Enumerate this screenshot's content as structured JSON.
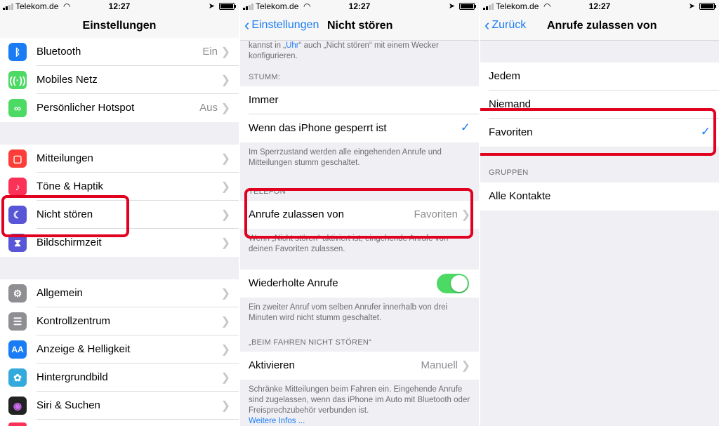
{
  "status": {
    "carrier": "Telekom.de",
    "time": "12:27"
  },
  "panel1": {
    "title": "Einstellungen",
    "group1": [
      {
        "label": "Bluetooth",
        "value": "Ein",
        "icon": "bluetooth-icon",
        "color": "#1a7cf5"
      },
      {
        "label": "Mobiles Netz",
        "value": "",
        "icon": "antenna-icon",
        "color": "#4cd964"
      },
      {
        "label": "Persönlicher Hotspot",
        "value": "Aus",
        "icon": "hotspot-icon",
        "color": "#4cd964"
      }
    ],
    "group2": [
      {
        "label": "Mitteilungen",
        "icon": "notifications-icon",
        "color": "#fc3d39"
      },
      {
        "label": "Töne & Haptik",
        "icon": "sound-icon",
        "color": "#fc3158"
      },
      {
        "label": "Nicht stören",
        "icon": "moon-icon",
        "color": "#5856d6"
      },
      {
        "label": "Bildschirmzeit",
        "icon": "hourglass-icon",
        "color": "#5856d6"
      }
    ],
    "group3": [
      {
        "label": "Allgemein",
        "icon": "gear-icon",
        "color": "#8e8e93"
      },
      {
        "label": "Kontrollzentrum",
        "icon": "switches-icon",
        "color": "#8e8e93"
      },
      {
        "label": "Anzeige & Helligkeit",
        "icon": "text-size-icon",
        "icon_text": "AA",
        "color": "#1a7cf5"
      },
      {
        "label": "Hintergrundbild",
        "icon": "wallpaper-icon",
        "color": "#34aadc"
      },
      {
        "label": "Siri & Suchen",
        "icon": "siri-icon",
        "color": "#222222"
      }
    ]
  },
  "panel2": {
    "back": "Einstellungen",
    "title": "Nicht stören",
    "top_text_a": "kannst in „",
    "top_text_link": "Uhr",
    "top_text_b": "“ auch „Nicht stören“ mit einem Wecker",
    "top_text_2": "konfigurieren.",
    "stumm_header": "STUMM:",
    "stumm_always": "Immer",
    "stumm_locked": "Wenn das iPhone gesperrt ist",
    "stumm_footer": "Im Sperrzustand werden alle eingehenden Anrufe und Mitteilungen stumm geschaltet.",
    "telefon_header": "TELEFON",
    "allow_calls": "Anrufe zulassen von",
    "allow_calls_value": "Favoriten",
    "allow_footer": "Wenn „Nicht stören“ aktiviert ist, eingehende Anrufe von deinen Favoriten zulassen.",
    "repeated_calls": "Wiederholte Anrufe",
    "repeated_footer": "Ein zweiter Anruf vom selben Anrufer innerhalb von drei Minuten wird nicht stumm geschaltet.",
    "driving_header": "„BEIM FAHREN NICHT STÖREN“",
    "activate": "Aktivieren",
    "activate_value": "Manuell",
    "driving_footer": "Schränke Mitteilungen beim Fahren ein. Eingehende Anrufe sind zugelassen, wenn das iPhone im Auto mit Bluetooth oder Freisprechzubehör verbunden ist.",
    "more_info": "Weitere Infos ..."
  },
  "panel3": {
    "back": "Zurück",
    "title": "Anrufe zulassen von",
    "options": [
      "Jedem",
      "Niemand",
      "Favoriten"
    ],
    "groups_header": "GRUPPEN",
    "all_contacts": "Alle Kontakte"
  }
}
